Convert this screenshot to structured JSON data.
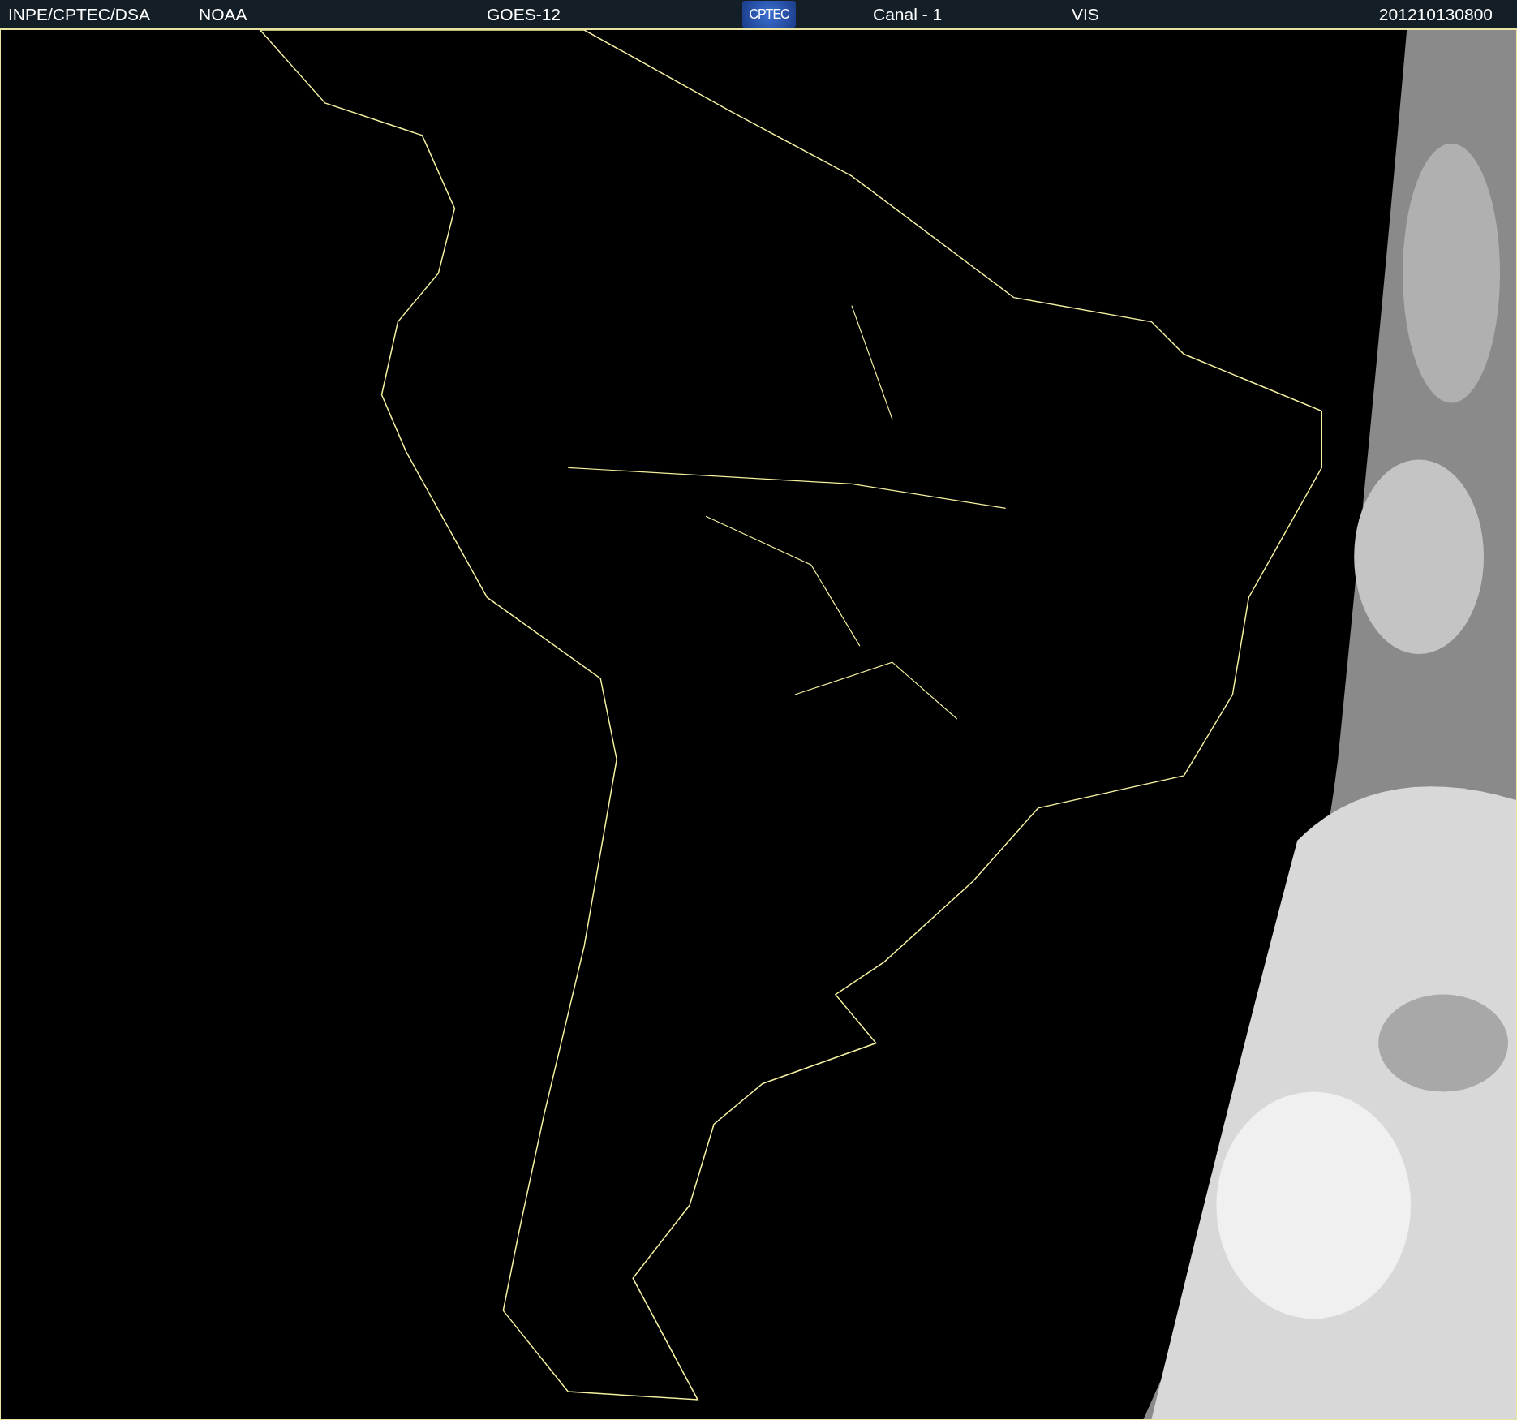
{
  "header": {
    "fields": [
      "INPE/CPTEC/DSA",
      "NOAA",
      "GOES-12"
    ],
    "logo": "CPTEC",
    "fields_right": [
      "Canal - 1",
      "VIS"
    ],
    "timestamp": "201210130800"
  }
}
